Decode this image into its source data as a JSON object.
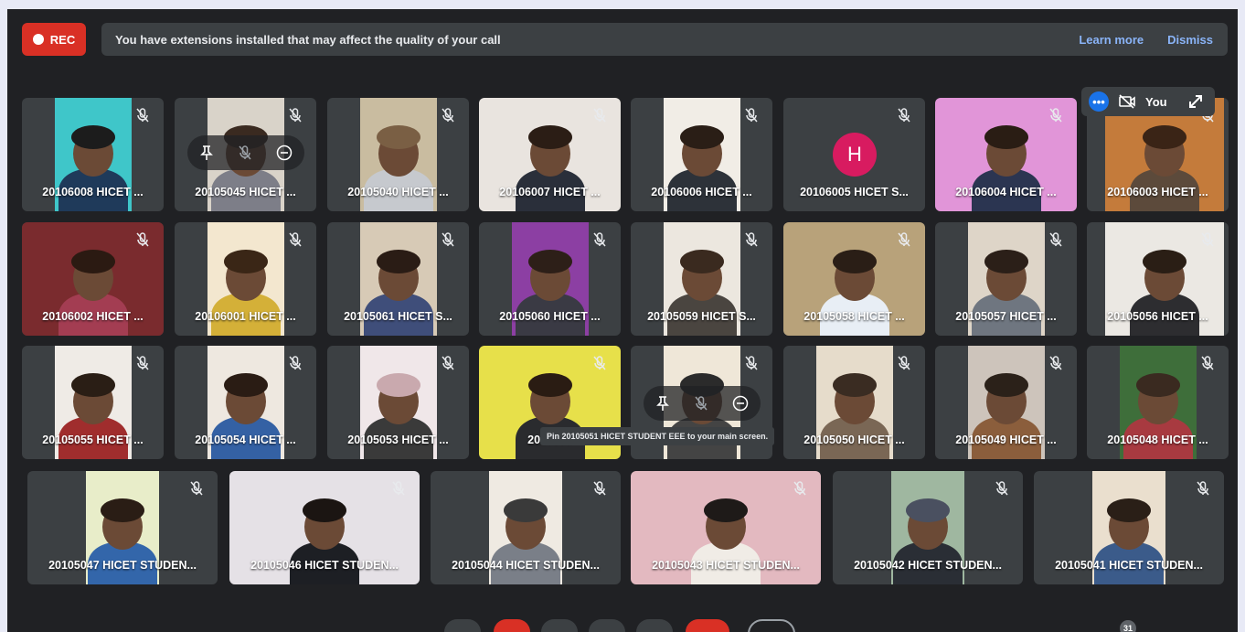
{
  "recording": {
    "label": "REC"
  },
  "banner": {
    "message": "You have extensions installed that may affect the quality of your call",
    "learn_more": "Learn more",
    "dismiss": "Dismiss"
  },
  "colors": {
    "accent": "#8ab4f8",
    "rec": "#d93025",
    "tile": "#3c4043",
    "background": "#202124"
  },
  "self_view": {
    "label": "You"
  },
  "participants_count": "31",
  "tooltip": "Pin 20105051 HICET STUDENT EEE to your main screen.",
  "participants": [
    {
      "name": "20106008 HICET ..."
    },
    {
      "name": "20105045 HICET ..."
    },
    {
      "name": "20105040 HICET ..."
    },
    {
      "name": "20106007 HICET ..."
    },
    {
      "name": "20106006 HICET ..."
    },
    {
      "name": "20106005 HICET S...",
      "avatar_letter": "H"
    },
    {
      "name": "20106004 HICET ..."
    },
    {
      "name": "20106003 HICET ..."
    },
    {
      "name": "20106002 HICET ..."
    },
    {
      "name": "20106001 HICET ..."
    },
    {
      "name": "20105061 HICET S..."
    },
    {
      "name": "20105060 HICET ..."
    },
    {
      "name": "20105059 HICET S..."
    },
    {
      "name": "20105058 HICET ..."
    },
    {
      "name": "20105057 HICET ..."
    },
    {
      "name": "20105056 HICET ..."
    },
    {
      "name": "20105055 HICET ..."
    },
    {
      "name": "20105054 HICET ..."
    },
    {
      "name": "20105053 HICET ..."
    },
    {
      "name": "2010505"
    },
    {
      "name": ""
    },
    {
      "name": "20105050 HICET ..."
    },
    {
      "name": "20105049 HICET ..."
    },
    {
      "name": "20105048 HICET ..."
    },
    {
      "name": "20105047 HICET STUDEN..."
    },
    {
      "name": "20105046 HICET STUDEN..."
    },
    {
      "name": "20105044 HICET STUDEN..."
    },
    {
      "name": "20105043 HICET STUDEN..."
    },
    {
      "name": "20105042 HICET STUDEN..."
    },
    {
      "name": "20105041 HICET STUDEN..."
    }
  ]
}
